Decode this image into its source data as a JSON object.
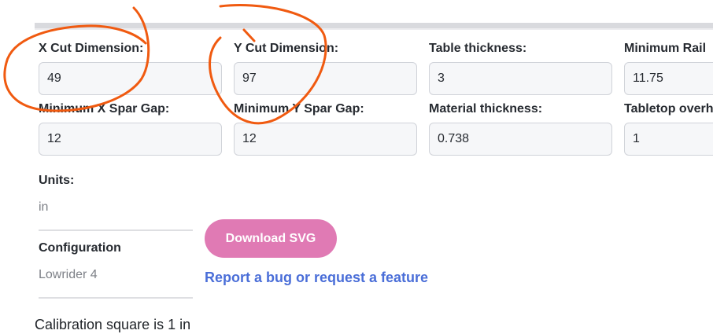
{
  "fields": {
    "x_cut": {
      "label": "X Cut Dimension:",
      "value": "49"
    },
    "y_cut": {
      "label": "Y Cut Dimension:",
      "value": "97"
    },
    "table_thickness": {
      "label": "Table thickness:",
      "value": "3"
    },
    "min_rail": {
      "label": "Minimum Rail",
      "value": "11.75"
    },
    "min_x_spar_gap": {
      "label": "Minimum X Spar Gap:",
      "value": "12"
    },
    "min_y_spar_gap": {
      "label": "Minimum Y Spar Gap:",
      "value": "12"
    },
    "material_thickness": {
      "label": "Material thickness:",
      "value": "0.738"
    },
    "tabletop_overhang": {
      "label": "Tabletop overh",
      "value": "1"
    }
  },
  "units": {
    "label": "Units:",
    "value": "in"
  },
  "configuration": {
    "label": "Configuration",
    "value": "Lowrider 4"
  },
  "actions": {
    "download_label": "Download SVG",
    "report_label": "Report a bug or request a feature"
  },
  "calibration_text": "Calibration square is 1 in",
  "colors": {
    "accent_button": "#e07ab4",
    "link": "#4a6ed8",
    "annotation": "#f05a10"
  }
}
